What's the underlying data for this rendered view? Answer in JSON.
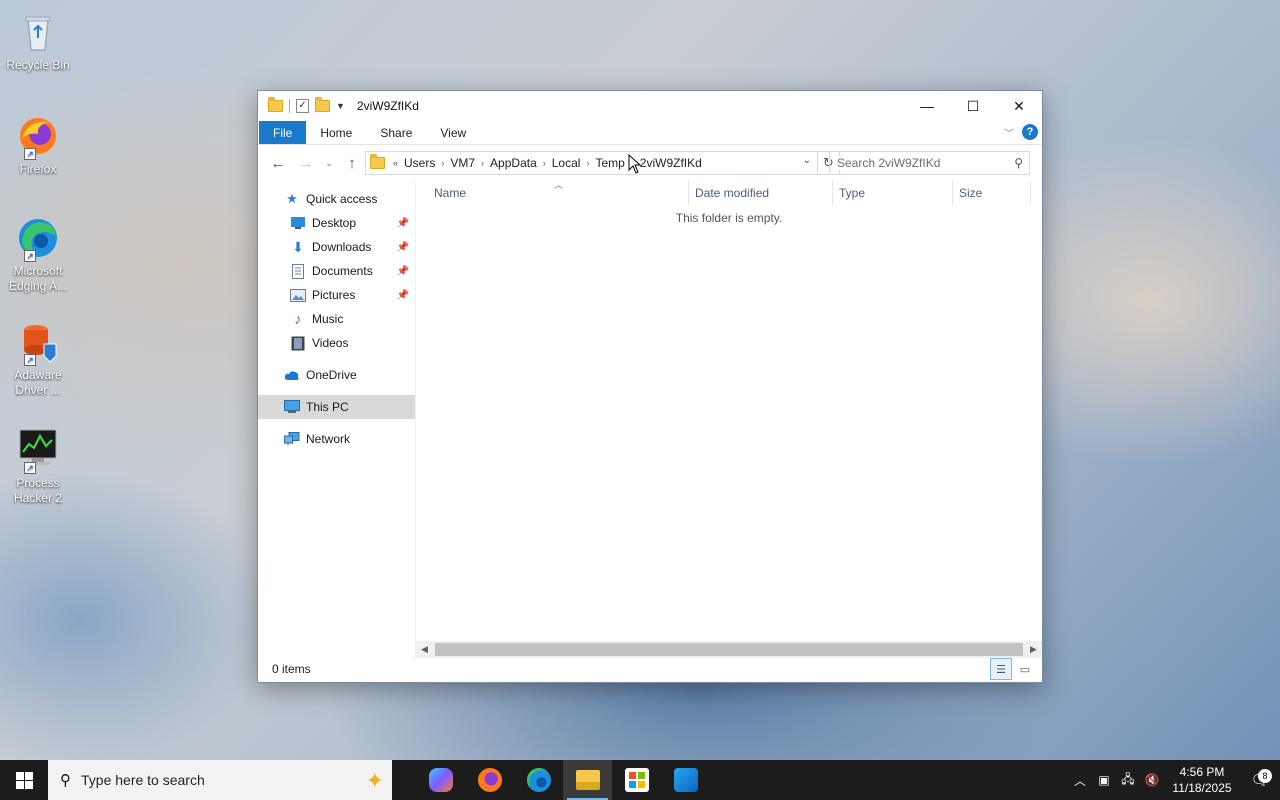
{
  "desktop": {
    "icons": [
      {
        "label": "Recycle Bin"
      },
      {
        "label": "Firefox"
      },
      {
        "label": "Microsoft Edging A..."
      },
      {
        "label": "Adaware Driver ..."
      },
      {
        "label": "Process Hacker 2"
      }
    ]
  },
  "window": {
    "title": "2viW9ZfIKd",
    "controls": {
      "minimize": "—",
      "maximize": "☐",
      "close": "✕"
    },
    "ribbon_tabs": [
      "File",
      "Home",
      "Share",
      "View"
    ],
    "help": "?",
    "address": {
      "overflow": "«",
      "crumbs": [
        "Users",
        "VM7",
        "AppData",
        "Local",
        "Temp",
        "2viW9ZfIKd"
      ]
    },
    "search_placeholder": "Search 2viW9ZfIKd",
    "nav": {
      "quick_access": "Quick access",
      "pinned": [
        "Desktop",
        "Downloads",
        "Documents",
        "Pictures"
      ],
      "unpinned": [
        "Music",
        "Videos"
      ],
      "onedrive": "OneDrive",
      "this_pc": "This PC",
      "network": "Network"
    },
    "columns": [
      "Name",
      "Date modified",
      "Type",
      "Size"
    ],
    "empty_message": "This folder is empty.",
    "status": "0 items"
  },
  "taskbar": {
    "search_placeholder": "Type here to search",
    "time": "4:56 PM",
    "date": "11/18/2025",
    "notification_count": "8",
    "apps": [
      "copilot-icon",
      "firefox-icon",
      "edge-icon",
      "file-explorer-icon",
      "store-icon",
      "outlook-icon"
    ]
  },
  "colors": {
    "accent": "#1979ca",
    "taskbar": "#1c1c1c",
    "selected_nav": "#d9d9d9"
  }
}
